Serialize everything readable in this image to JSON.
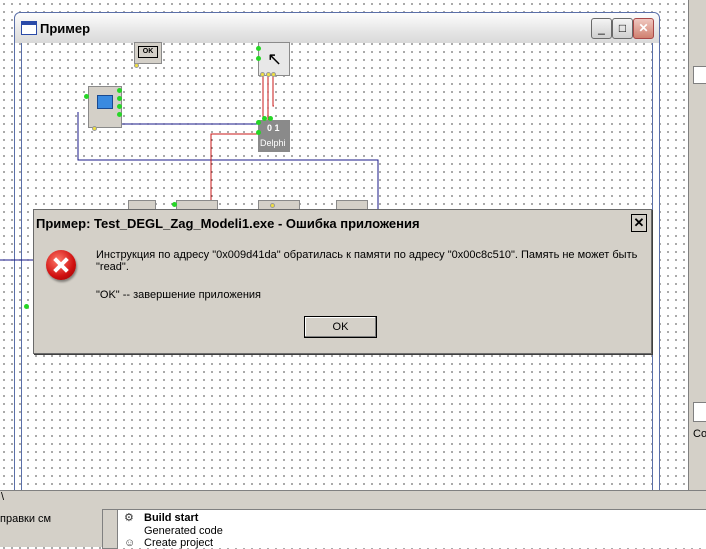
{
  "main_window": {
    "title": "Пример",
    "minimize_glyph": "_",
    "maximize_glyph": "□",
    "close_glyph": "✕"
  },
  "form_components": {
    "ok_button_label": "OK",
    "delphi_label": "Delphi",
    "delphi_digits": "0 1"
  },
  "error_dialog": {
    "title": "Пример: Test_DEGL_Zag_Modeli1.exe - Ошибка приложения",
    "close_glyph": "✕",
    "message": "Инструкция по адресу \"0x009d41da\" обратилась к памяти по адресу \"0x00c8c510\". Память не может быть \"read\".",
    "hint": "\"OK\" -- завершение приложения",
    "ok_label": "OK",
    "icon": "error-icon"
  },
  "right_panel": {
    "label": "Со"
  },
  "bottom_panel": {
    "left_text": "правки см",
    "backslash": "\\",
    "log": [
      {
        "icon": "build-icon",
        "text": "Build start",
        "bold": true
      },
      {
        "icon": "",
        "text": "Generated code",
        "bold": false
      },
      {
        "icon": "people-icon",
        "text": "Create project",
        "bold": false
      }
    ]
  },
  "colors": {
    "error_red": "#d01010",
    "wire_red": "#c81818",
    "wire_blue": "#1a1a8a",
    "pin_green": "#26d626"
  }
}
